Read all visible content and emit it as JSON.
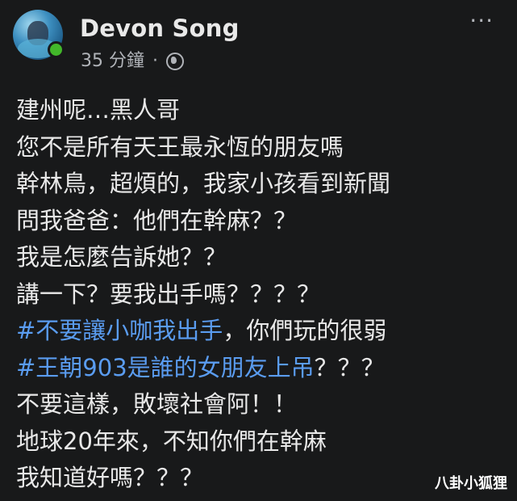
{
  "post": {
    "author": "Devon Song",
    "time": "35 分鐘",
    "separator": "·",
    "more_label": "···",
    "lines": [
      {
        "text": "建州呢…黑人哥"
      },
      {
        "text": "您不是所有天王最永恆的朋友嗎"
      },
      {
        "text": "幹林鳥，超煩的，我家小孩看到新聞"
      },
      {
        "text": "問我爸爸：他們在幹麻？？"
      },
      {
        "text": "我是怎麼告訴她？？"
      },
      {
        "text": "講一下？要我出手嗎？？？？"
      },
      {
        "hashtag": "#不要讓小咖我出手",
        "rest": "，你們玩的很弱"
      },
      {
        "hashtag": "#王朝903是誰的女朋友上吊",
        "rest": "？？？"
      },
      {
        "text": "不要這樣，敗壞社會阿！！"
      },
      {
        "text": "地球20年來，不知你們在幹麻"
      },
      {
        "text": "我知道好嗎？？？"
      }
    ]
  },
  "watermark": "八卦小狐狸",
  "colors": {
    "background": "#18191a",
    "text": "#e8e8e8",
    "hashtag": "#5a9cf0",
    "online": "#42b72a"
  },
  "icons": {
    "globe": "globe-icon",
    "more": "more-options-icon"
  }
}
